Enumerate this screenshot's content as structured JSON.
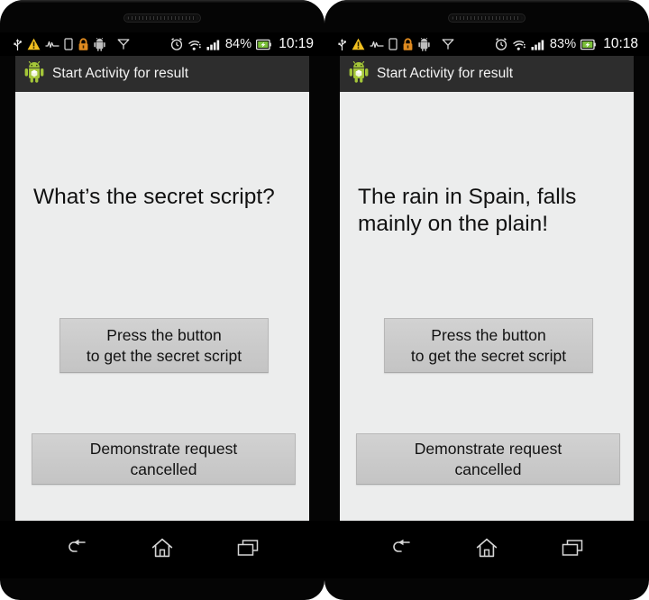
{
  "devices": [
    {
      "id": "left",
      "status_bar": {
        "icons": [
          "usb-icon",
          "warning-icon",
          "vibrate-icon",
          "sim-card-icon",
          "lock-icon",
          "android-debug-icon",
          "no-sim-icon",
          "alarm-icon",
          "wifi-icon",
          "signal-icon"
        ],
        "battery_percent": "84%",
        "battery_icon": "battery-charging-icon",
        "clock": "10:19"
      },
      "app_bar": {
        "icon": "android-app-icon",
        "title": "Start Activity for result"
      },
      "content": {
        "prompt": "What’s the secret script?",
        "buttons": [
          {
            "name": "secret-script-button",
            "line1": "Press the button",
            "line2": "to get the secret script"
          },
          {
            "name": "demonstrate-cancel-button",
            "line1": "Demonstrate request",
            "line2": "cancelled"
          }
        ]
      },
      "nav_bar": {
        "back": "back-icon",
        "home": "home-icon",
        "recents": "recents-icon"
      }
    },
    {
      "id": "right",
      "status_bar": {
        "icons": [
          "usb-icon",
          "warning-icon",
          "vibrate-icon",
          "sim-card-icon",
          "lock-icon",
          "android-debug-icon",
          "no-sim-icon",
          "alarm-icon",
          "wifi-icon",
          "signal-icon"
        ],
        "battery_percent": "83%",
        "battery_icon": "battery-charging-icon",
        "clock": "10:18"
      },
      "app_bar": {
        "icon": "android-app-icon",
        "title": "Start Activity for result"
      },
      "content": {
        "prompt": "The rain in Spain, falls mainly on the plain!",
        "buttons": [
          {
            "name": "secret-script-button",
            "line1": "Press the button",
            "line2": "to get the secret script"
          },
          {
            "name": "demonstrate-cancel-button",
            "line1": "Demonstrate request",
            "line2": "cancelled"
          }
        ]
      },
      "nav_bar": {
        "back": "back-icon",
        "home": "home-icon",
        "recents": "recents-icon"
      }
    }
  ],
  "colors": {
    "bezel": "#050505",
    "status_bar_bg": "#000000",
    "app_bar_bg": "#2d2d2d",
    "screen_bg": "#eceded",
    "button_bg": "#cbcbcb",
    "text": "#111111",
    "warning": "#f0c020",
    "lock": "#e08b20",
    "android_green": "#9fc22a"
  }
}
